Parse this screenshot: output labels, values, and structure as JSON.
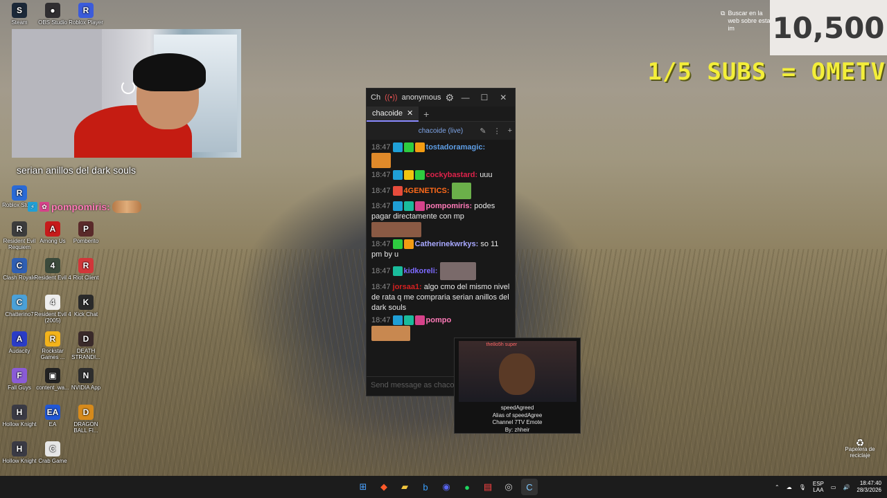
{
  "desktop": {
    "icons": [
      {
        "label": "Steam",
        "icon": "steam-icon",
        "color": "#1b2838",
        "glyph": "S"
      },
      {
        "label": "OBS Studio",
        "icon": "obs-icon",
        "color": "#302e31",
        "glyph": "●"
      },
      {
        "label": "Roblox Player",
        "icon": "roblox-icon",
        "color": "#3b5bdb",
        "glyph": "R"
      },
      {
        "label": "Roblox Studio",
        "icon": "roblox-studio-icon",
        "color": "#2a6ad6",
        "glyph": "R"
      },
      {
        "label": "Resident Evil Requiem",
        "icon": "resident-evil-icon",
        "color": "#3c3c3c",
        "glyph": "R"
      },
      {
        "label": "Among Us",
        "icon": "among-us-icon",
        "color": "#c61b1b",
        "glyph": "A"
      },
      {
        "label": "Pomberito",
        "icon": "pomberito-icon",
        "color": "#5a2a2a",
        "glyph": "P"
      },
      {
        "label": "Clash Royale",
        "icon": "clash-royale-icon",
        "color": "#2f5fb3",
        "glyph": "C"
      },
      {
        "label": "Resident Evil 4",
        "icon": "resident-evil-4-icon",
        "color": "#3b4a3b",
        "glyph": "4"
      },
      {
        "label": "Riot Client",
        "icon": "riot-icon",
        "color": "#d13639",
        "glyph": "R"
      },
      {
        "label": "Chatterino7",
        "icon": "chatterino-icon",
        "color": "#4aa0d8",
        "glyph": "C"
      },
      {
        "label": "Resident Evil 4 (2005)",
        "icon": "resident-evil-2005-icon",
        "color": "#eeeeee",
        "glyph": "4"
      },
      {
        "label": "Kick Chat",
        "icon": "kick-chat-icon",
        "color": "#2a2a2a",
        "glyph": "K"
      },
      {
        "label": "Audacity",
        "icon": "audacity-icon",
        "color": "#2a3cc6",
        "glyph": "A"
      },
      {
        "label": "Rockstar Games ...",
        "icon": "rockstar-icon",
        "color": "#f3b31b",
        "glyph": "R"
      },
      {
        "label": "DEATH STRANDI...",
        "icon": "death-stranding-icon",
        "color": "#3a2a2a",
        "glyph": "D"
      },
      {
        "label": "Fall Guys",
        "icon": "fall-guys-icon",
        "color": "#8a5bd6",
        "glyph": "F"
      },
      {
        "label": "content_wa...",
        "icon": "content-icon",
        "color": "#222222",
        "glyph": "▣"
      },
      {
        "label": "NVIDIA App",
        "icon": "nvidia-icon",
        "color": "#2d2d2d",
        "glyph": "N"
      },
      {
        "label": "Hollow Knight",
        "icon": "hollow-knight-icon",
        "color": "#3a3a44",
        "glyph": "H"
      },
      {
        "label": "EA",
        "icon": "ea-icon",
        "color": "#2157d6",
        "glyph": "EA"
      },
      {
        "label": "DRAGON BALL FI...",
        "icon": "dragon-ball-icon",
        "color": "#d68a1b",
        "glyph": "D"
      },
      {
        "label": "Hollow Knight",
        "icon": "hollow-knight-2-icon",
        "color": "#3a3a44",
        "glyph": "H"
      },
      {
        "label": "Crab Game",
        "icon": "crab-game-icon",
        "color": "#e6e6e6",
        "glyph": "C"
      }
    ],
    "recycle_bin": "Papelera de reciclaje"
  },
  "stream_overlay": {
    "caption": "serian anillos del dark souls",
    "username": "pompomiris:",
    "counter": "10,500",
    "goal": "1/5 SUBS = OMETV",
    "search_hint": "Buscar en la web sobre esta im"
  },
  "chat": {
    "title": "Ch",
    "account": "anonymous",
    "tab_label": "chacoide",
    "channel_label": "chacoide (live)",
    "input_placeholder": "Send message as chacoi",
    "messages": [
      {
        "time": "18:47",
        "user": "tostadoramagic:",
        "color": "#5e9ee6",
        "text": ""
      },
      {
        "time": "18:47",
        "user": "cockybastard:",
        "color": "#e0224b",
        "text": "uuu"
      },
      {
        "time": "18:47",
        "user": "4GENETICS:",
        "color": "#ff6a1a",
        "text": ""
      },
      {
        "time": "18:47",
        "user": "pompomiris:",
        "color": "#ff7ab8",
        "text": "podes pagar directamente con mp"
      },
      {
        "time": "18:47",
        "user": "Catherinekwrkys:",
        "color": "#a8a8ff",
        "text": "so 11 pm by u"
      },
      {
        "time": "18:47",
        "user": "kidkoreli:",
        "color": "#7d6bff",
        "text": ""
      },
      {
        "time": "18:47",
        "user": "jorsaa1:",
        "color": "#d62121",
        "text": "algo cmo del mismo nivel de rata q me compraria serian anillos del dark souls"
      },
      {
        "time": "18:47",
        "user": "pompo",
        "color": "#ff7ab8",
        "text": ""
      }
    ]
  },
  "tooltip": {
    "image_tag": "the8o5h super",
    "name": "speedAgreed",
    "alias": "Alias of speedAgree",
    "type": "Channel 7TV Emote",
    "author": "By: zhheir"
  },
  "taskbar": {
    "language": "ESP",
    "layout": "LAA",
    "time": "18:47:40",
    "date": "28/3/2026"
  }
}
